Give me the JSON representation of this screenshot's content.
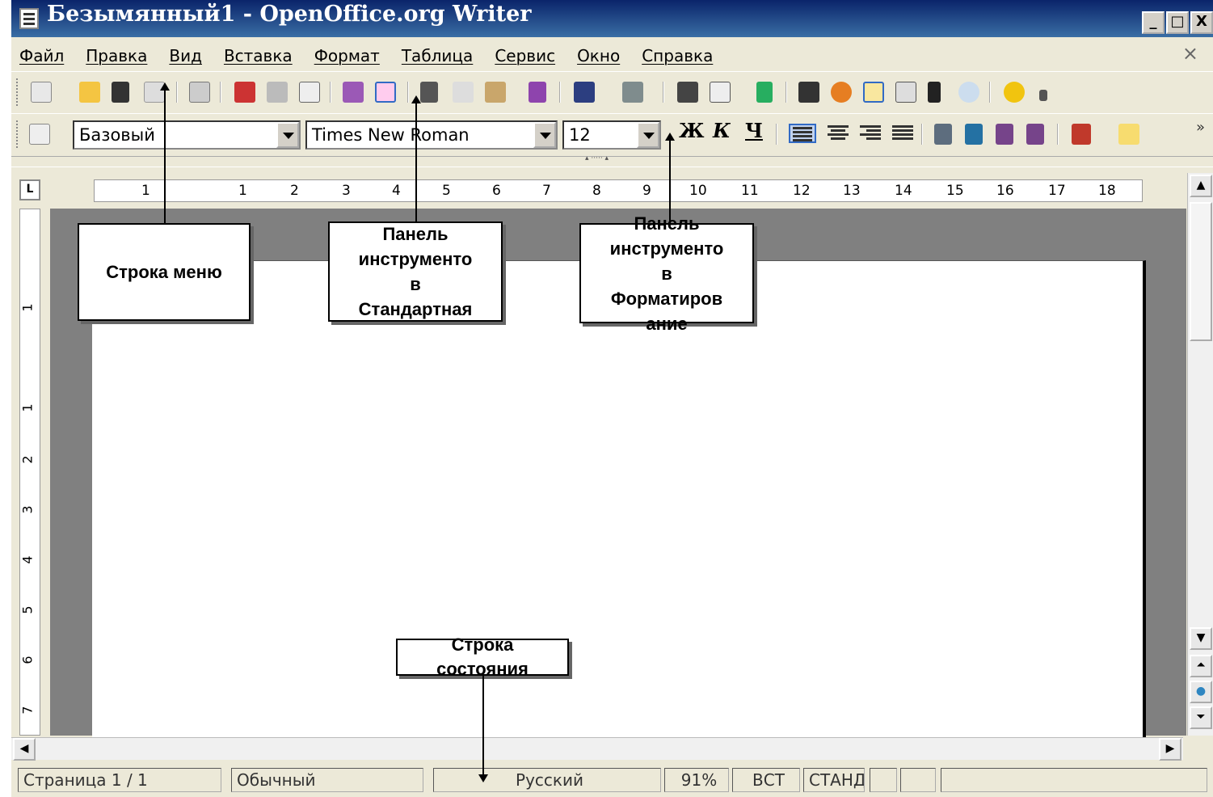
{
  "window": {
    "title": "Безымянный1 - OpenOffice.org Writer",
    "btn_min": "_",
    "btn_max": "□",
    "btn_close": "X"
  },
  "menu": {
    "items": [
      "Файл",
      "Правка",
      "Вид",
      "Вставка",
      "Формат",
      "Таблица",
      "Сервис",
      "Окно",
      "Справка"
    ],
    "close": "×"
  },
  "format_toolbar": {
    "style_value": "Базовый",
    "font_value": "Times New Roman",
    "size_value": "12",
    "bold": "Ж",
    "italic": "К",
    "underline": "Ч"
  },
  "ruler": {
    "corner": "L",
    "h_marks": [
      "1",
      "1",
      "2",
      "3",
      "4",
      "5",
      "6",
      "7",
      "8",
      "9",
      "10",
      "11",
      "12",
      "13",
      "14",
      "15",
      "16",
      "17",
      "18"
    ],
    "v_marks": [
      "1",
      "1",
      "2",
      "3",
      "4",
      "5",
      "6",
      "7"
    ]
  },
  "statusbar": {
    "page": "Страница  1 / 1",
    "style": "Обычный",
    "language": "Русский",
    "zoom": "91%",
    "insert_mode": "ВСТ",
    "selection_mode": "СТАНД"
  },
  "callouts": {
    "menu_bar": "Строка меню",
    "standard_toolbar": "Панель\nинструменто\nв\nСтандартная",
    "format_toolbar": "Панель\nинструменто\nв\nФорматиров\nание",
    "status_bar": "Строка\nсостояния"
  },
  "colors": {
    "titlebar": "#0a246a",
    "window_bg": "#ece9d8",
    "doc_bg": "#808080"
  }
}
